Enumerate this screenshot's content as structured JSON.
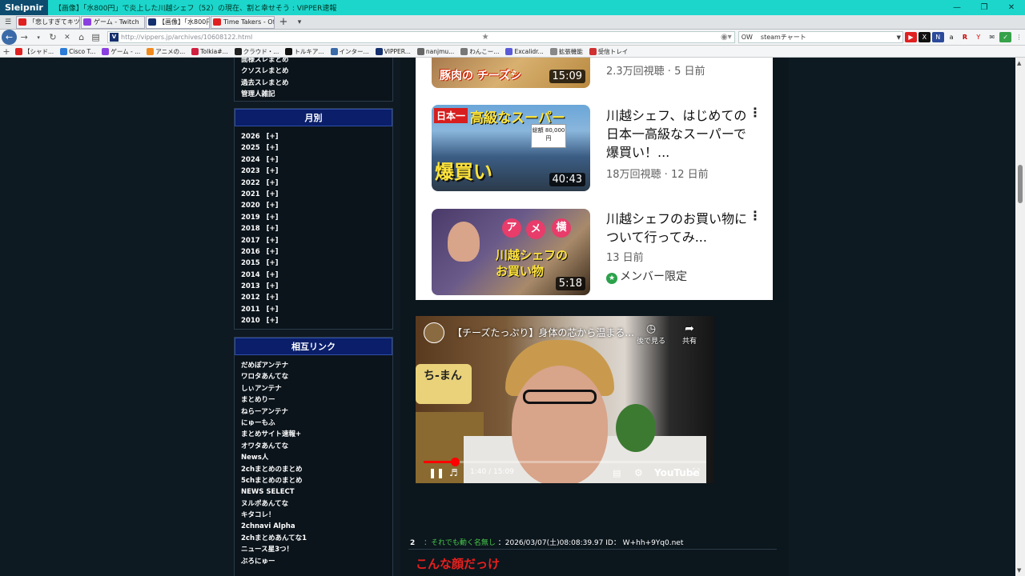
{
  "browser": {
    "logo": "Sleipnir",
    "title": "【画像】「水800円」で炎上した川越シェフ（52）の現在、割と幸せそう : VIPPER速報",
    "tabs": [
      {
        "label": "「悲しすぎてキツい...",
        "icon": "youtube-icon",
        "color": "#e02020",
        "active": false
      },
      {
        "label": "ゲーム - Twitch",
        "icon": "twitch-icon",
        "color": "#8a3fe0",
        "active": false
      },
      {
        "label": "【画像】「水800円...",
        "icon": "vipper-icon",
        "color": "#15306e",
        "active": true
      },
      {
        "label": "Time Takers - Of...",
        "icon": "youtube-icon",
        "color": "#e02020",
        "active": false
      }
    ],
    "url": "http://vippers.jp/archives/10608122.html",
    "search_engine_label": "OW",
    "search_value": "steamチャート",
    "bookmarks": [
      {
        "label": "【シャド...",
        "color": "#e02020"
      },
      {
        "label": "Cisco T...",
        "color": "#2b7bd8"
      },
      {
        "label": "ゲーム - ...",
        "color": "#8a3fe0"
      },
      {
        "label": "アニメの...",
        "color": "#f08a1c"
      },
      {
        "label": "Tolkia#...",
        "color": "#d02040"
      },
      {
        "label": "クラウド・...",
        "color": "#222222"
      },
      {
        "label": "トルキア...",
        "color": "#111111"
      },
      {
        "label": "インター...",
        "color": "#3a6aa8"
      },
      {
        "label": "VIPPER...",
        "color": "#15306e"
      },
      {
        "label": "nanjmu...",
        "color": "#666666"
      },
      {
        "label": "わんこー...",
        "color": "#777777"
      },
      {
        "label": "Excalidr...",
        "color": "#5a5ad8"
      },
      {
        "label": "拡張機能",
        "color": "#888888"
      },
      {
        "label": "受信トレイ",
        "color": "#d03030"
      }
    ]
  },
  "sidebar": {
    "top_links": [
      "面様スレまとめ",
      "クソスレまとめ",
      "過去スレまとめ",
      "管理人雑記"
    ],
    "monthly": {
      "header": "月別",
      "expand_label": "[+]",
      "years": [
        "2026",
        "2025",
        "2024",
        "2023",
        "2022",
        "2021",
        "2020",
        "2019",
        "2018",
        "2017",
        "2016",
        "2015",
        "2014",
        "2013",
        "2012",
        "2011",
        "2010"
      ]
    },
    "links": {
      "header": "相互リンク",
      "items": [
        "だめぽアンテナ",
        "ワロタあんてな",
        "しぃアンテナ",
        "まとめりー",
        "ねらーアンテナ",
        "にゅーもふ",
        "まとめサイト速報+",
        "オワタあんてな",
        "News人",
        "2chまとめのまとめ",
        "5chまとめのまとめ",
        "NEWS SELECT",
        "ヌルポあんてな",
        "キタコレ！",
        "2chnavi Alpha",
        "2chまとめあんてな1",
        "ニュース星3つ！",
        "ぶろにゅー"
      ]
    }
  },
  "videos": [
    {
      "thumb_text": "豚肉の チーズシ",
      "duration": "15:09",
      "title": "",
      "meta": "2.3万回視聴 · 5 日前"
    },
    {
      "thumb_text": "日本一 高級なスーパー 爆買い",
      "price_tag": "総額 80,000円",
      "duration": "40:43",
      "title": "川越シェフ、はじめての日本一高級なスーパーで爆買い！...",
      "meta": "18万回視聴 · 12 日前"
    },
    {
      "thumb_text": "アメ横 川越シェフのお買い物",
      "duration": "5:18",
      "title": "川越シェフのお買い物について行ってみ...",
      "meta": "13 日前",
      "badge": "メンバー限定"
    }
  ],
  "embed": {
    "title": "【チーズたっぷり】身体の芯から温まる...",
    "watch_later": "後で見る",
    "share": "共有",
    "time": "1:40 / 15:09",
    "progress": 0.11,
    "brand": "YouTube"
  },
  "post": {
    "number": "2",
    "name": "：それでも動く名無し",
    "date": "：2026/03/07(土)08:08:39.97 ID： W+hh+9Yq0.net",
    "quote": "こんな顔だっけ"
  }
}
